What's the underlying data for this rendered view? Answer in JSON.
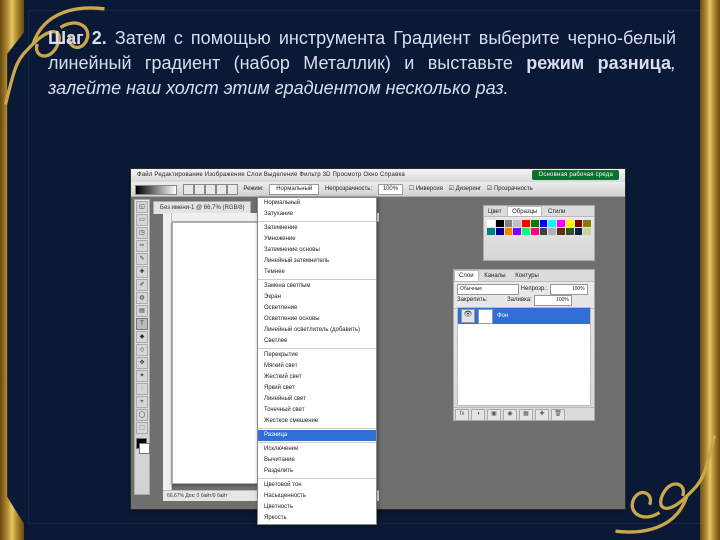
{
  "slide": {
    "step_label": "Шаг 2.",
    "text_after_step": " Затем с помощью инструмента Градиент выберите черно-белый линейный градиент (набор Металлик) и выставьте ",
    "bold_mode": "режим разница",
    "text_tail": ", залейте наш холст этим градиентом несколько раз."
  },
  "menubar": {
    "items": [
      "Файл",
      "Редактирование",
      "Изображение",
      "Слои",
      "Выделение",
      "Фильтр",
      "3D",
      "Просмотр",
      "Окно",
      "Справка"
    ]
  },
  "optionsbar": {
    "mode_label": "Режим:",
    "mode_value": "Нормальный",
    "opacity_label": "Непрозрачность:",
    "opacity_value": "100%",
    "checkbox1": "Инверсия",
    "checkbox2": "Дизеринг",
    "checkbox3": "Прозрачность",
    "workspace_button": "Основная рабочая среда"
  },
  "document": {
    "tab_title": "Без имени-1 @ 66,7% (RGB/8)",
    "status": "66,67%      Док: 0 байт/0 байт"
  },
  "blend_modes": {
    "items": [
      "Нормальный",
      "Затухание",
      "",
      "Затемнение",
      "Умножение",
      "Затемнение основы",
      "Линейный затемнитель",
      "Темнее",
      "",
      "Замена светлым",
      "Экран",
      "Осветление",
      "Осветление основы",
      "Линейный осветлитель (добавить)",
      "Светлее",
      "",
      "Перекрытие",
      "Мягкий свет",
      "Жесткий свет",
      "Яркий свет",
      "Линейный свет",
      "Точечный свет",
      "Жесткое смешение",
      "",
      "Разница",
      "",
      "Исключение",
      "Вычитание",
      "Разделить",
      "",
      "Цветовой тон",
      "Насыщенность",
      "Цветность",
      "Яркость"
    ],
    "highlighted": "Разница"
  },
  "swatches_panel": {
    "tab1": "Цвет",
    "tab2": "Образцы",
    "tab3": "Стили",
    "colors": [
      "#ffffff",
      "#000000",
      "#808080",
      "#c0c0c0",
      "#ff0000",
      "#008000",
      "#0000ff",
      "#00ffff",
      "#ff00ff",
      "#ffff00",
      "#800000",
      "#808000",
      "#008080",
      "#000080",
      "#ff8000",
      "#8000ff",
      "#00ff80",
      "#ff0080",
      "#404040",
      "#b0b0b0",
      "#603010",
      "#305030",
      "#102040",
      "#d0d0a0"
    ]
  },
  "layers_panel": {
    "tab1": "Слои",
    "tab2": "Каналы",
    "tab3": "Контуры",
    "blend": "Обычные",
    "opacity_label": "Непрозр.:",
    "opacity_value": "100%",
    "lock_label": "Закрепить:",
    "fill_label": "Заливка:",
    "fill_value": "100%",
    "layer_name": "Фон",
    "foot_icons": [
      "fx",
      "◑",
      "▣",
      "◉",
      "▦",
      "✚",
      "🗑"
    ]
  }
}
